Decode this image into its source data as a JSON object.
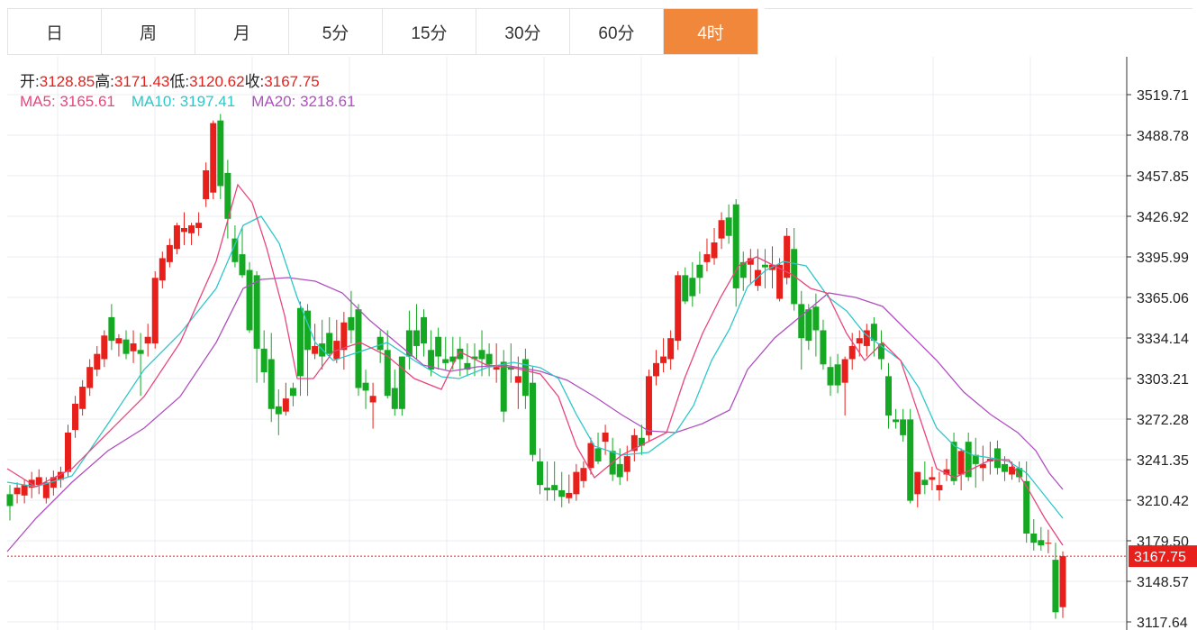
{
  "tabs": [
    {
      "label": "日"
    },
    {
      "label": "周"
    },
    {
      "label": "月"
    },
    {
      "label": "5分"
    },
    {
      "label": "15分"
    },
    {
      "label": "30分"
    },
    {
      "label": "60分"
    },
    {
      "label": "4时"
    }
  ],
  "active_tab_index": 7,
  "colors": {
    "up": "#e8201b",
    "down": "#14a823",
    "active_tab": "#f1873b",
    "ma5": "#e8467c",
    "ma10": "#2ec7c9",
    "ma20": "#b04fc0",
    "grid": "#e8ecf2"
  },
  "ohlc": {
    "open_label": "开:",
    "open": "3128.85",
    "high_label": "高:",
    "high": "3171.43",
    "low_label": "低:",
    "low": "3120.62",
    "close_label": "收:",
    "close": "3167.75"
  },
  "ma": {
    "ma5_label": "MA5:",
    "ma5": "3165.61",
    "ma10_label": "MA10:",
    "ma10": "3197.41",
    "ma20_label": "MA20:",
    "ma20": "3218.61"
  },
  "chart_data": {
    "type": "candlestick",
    "y_ticks": [
      "3519.71",
      "3488.78",
      "3457.85",
      "3426.92",
      "3395.99",
      "3365.06",
      "3334.14",
      "3303.21",
      "3272.28",
      "3241.35",
      "3210.42",
      "3179.50",
      "3148.57",
      "3117.64"
    ],
    "ylim": [
      3110,
      3545
    ],
    "current_price_label": "3167.75",
    "current_price": 3167.75,
    "candles": [
      [
        3215,
        3222,
        3195,
        3206
      ],
      [
        3215,
        3224,
        3208,
        3220
      ],
      [
        3214,
        3226,
        3208,
        3222
      ],
      [
        3220,
        3232,
        3212,
        3226
      ],
      [
        3222,
        3234,
        3215,
        3228
      ],
      [
        3212,
        3228,
        3208,
        3224
      ],
      [
        3220,
        3233,
        3214,
        3228
      ],
      [
        3226,
        3236,
        3220,
        3232
      ],
      [
        3232,
        3268,
        3228,
        3262
      ],
      [
        3264,
        3290,
        3258,
        3284
      ],
      [
        3280,
        3302,
        3275,
        3297
      ],
      [
        3296,
        3318,
        3290,
        3312
      ],
      [
        3310,
        3328,
        3305,
        3322
      ],
      [
        3318,
        3340,
        3312,
        3336
      ],
      [
        3350,
        3360,
        3325,
        3332
      ],
      [
        3330,
        3337,
        3320,
        3334
      ],
      [
        3333,
        3340,
        3318,
        3322
      ],
      [
        3324,
        3340,
        3315,
        3330
      ],
      [
        3325,
        3338,
        3290,
        3322
      ],
      [
        3330,
        3345,
        3320,
        3335
      ],
      [
        3330,
        3385,
        3326,
        3380
      ],
      [
        3378,
        3400,
        3372,
        3395
      ],
      [
        3392,
        3410,
        3388,
        3405
      ],
      [
        3402,
        3422,
        3398,
        3420
      ],
      [
        3415,
        3430,
        3405,
        3418
      ],
      [
        3414,
        3422,
        3405,
        3420
      ],
      [
        3418,
        3430,
        3412,
        3422
      ],
      [
        3440,
        3468,
        3434,
        3462
      ],
      [
        3445,
        3500,
        3440,
        3498
      ],
      [
        3500,
        3505,
        3440,
        3450
      ],
      [
        3460,
        3470,
        3410,
        3425
      ],
      [
        3410,
        3420,
        3388,
        3392
      ],
      [
        3398,
        3418,
        3380,
        3382
      ],
      [
        3386,
        3392,
        3338,
        3340
      ],
      [
        3382,
        3385,
        3300,
        3326
      ],
      [
        3326,
        3340,
        3300,
        3308
      ],
      [
        3318,
        3338,
        3270,
        3280
      ],
      [
        3282,
        3295,
        3260,
        3276
      ],
      [
        3278,
        3300,
        3275,
        3288
      ],
      [
        3296,
        3300,
        3282,
        3290
      ],
      [
        3357,
        3362,
        3290,
        3305
      ],
      [
        3355,
        3360,
        3290,
        3325
      ],
      [
        3322,
        3345,
        3318,
        3328
      ],
      [
        3330,
        3348,
        3310,
        3320
      ],
      [
        3338,
        3350,
        3320,
        3322
      ],
      [
        3318,
        3348,
        3315,
        3332
      ],
      [
        3325,
        3354,
        3310,
        3346
      ],
      [
        3350,
        3370,
        3330,
        3340
      ],
      [
        3356,
        3360,
        3290,
        3296
      ],
      [
        3300,
        3310,
        3280,
        3294
      ],
      [
        3285,
        3300,
        3265,
        3290
      ],
      [
        3335,
        3340,
        3315,
        3325
      ],
      [
        3325,
        3340,
        3288,
        3290
      ],
      [
        3296,
        3310,
        3275,
        3280
      ],
      [
        3320,
        3320,
        3275,
        3280
      ],
      [
        3340,
        3355,
        3310,
        3320
      ],
      [
        3340,
        3360,
        3318,
        3328
      ],
      [
        3350,
        3356,
        3320,
        3330
      ],
      [
        3325,
        3340,
        3305,
        3310
      ],
      [
        3335,
        3342,
        3310,
        3320
      ],
      [
        3318,
        3335,
        3310,
        3315
      ],
      [
        3320,
        3335,
        3310,
        3316
      ],
      [
        3326,
        3335,
        3305,
        3318
      ],
      [
        3315,
        3330,
        3305,
        3310
      ],
      [
        3320,
        3330,
        3305,
        3318
      ],
      [
        3325,
        3340,
        3305,
        3318
      ],
      [
        3322,
        3330,
        3305,
        3314
      ],
      [
        3310,
        3330,
        3300,
        3312
      ],
      [
        3316,
        3325,
        3270,
        3278
      ],
      [
        3312,
        3330,
        3300,
        3310
      ],
      [
        3300,
        3320,
        3280,
        3305
      ],
      [
        3318,
        3326,
        3280,
        3290
      ],
      [
        3300,
        3312,
        3240,
        3245
      ],
      [
        3240,
        3250,
        3215,
        3222
      ],
      [
        3220,
        3240,
        3210,
        3218
      ],
      [
        3222,
        3240,
        3210,
        3218
      ],
      [
        3218,
        3232,
        3205,
        3213
      ],
      [
        3212,
        3230,
        3208,
        3216
      ],
      [
        3215,
        3238,
        3210,
        3232
      ],
      [
        3225,
        3240,
        3220,
        3235
      ],
      [
        3235,
        3258,
        3230,
        3254
      ],
      [
        3250,
        3262,
        3238,
        3240
      ],
      [
        3255,
        3268,
        3245,
        3262
      ],
      [
        3248,
        3258,
        3225,
        3230
      ],
      [
        3238,
        3250,
        3222,
        3228
      ],
      [
        3232,
        3252,
        3225,
        3244
      ],
      [
        3248,
        3265,
        3240,
        3260
      ],
      [
        3258,
        3268,
        3245,
        3252
      ],
      [
        3260,
        3310,
        3255,
        3305
      ],
      [
        3305,
        3325,
        3298,
        3315
      ],
      [
        3315,
        3334,
        3308,
        3320
      ],
      [
        3318,
        3340,
        3310,
        3334
      ],
      [
        3332,
        3385,
        3325,
        3382
      ],
      [
        3382,
        3388,
        3360,
        3362
      ],
      [
        3380,
        3392,
        3358,
        3366
      ],
      [
        3390,
        3400,
        3368,
        3380
      ],
      [
        3392,
        3410,
        3385,
        3398
      ],
      [
        3395,
        3418,
        3390,
        3407
      ],
      [
        3410,
        3430,
        3402,
        3424
      ],
      [
        3426,
        3436,
        3406,
        3412
      ],
      [
        3436,
        3440,
        3358,
        3372
      ],
      [
        3392,
        3400,
        3370,
        3380
      ],
      [
        3390,
        3402,
        3375,
        3395
      ],
      [
        3374,
        3402,
        3370,
        3386
      ],
      [
        3390,
        3402,
        3372,
        3388
      ],
      [
        3386,
        3404,
        3372,
        3390
      ],
      [
        3364,
        3395,
        3362,
        3390
      ],
      [
        3380,
        3418,
        3375,
        3412
      ],
      [
        3402,
        3418,
        3355,
        3360
      ],
      [
        3360,
        3370,
        3310,
        3334
      ],
      [
        3356,
        3360,
        3325,
        3332
      ],
      [
        3358,
        3368,
        3320,
        3340
      ],
      [
        3340,
        3348,
        3310,
        3314
      ],
      [
        3312,
        3320,
        3290,
        3298
      ],
      [
        3314,
        3322,
        3292,
        3298
      ],
      [
        3300,
        3320,
        3275,
        3318
      ],
      [
        3318,
        3338,
        3310,
        3328
      ],
      [
        3330,
        3340,
        3320,
        3334
      ],
      [
        3328,
        3345,
        3320,
        3340
      ],
      [
        3345,
        3350,
        3320,
        3332
      ],
      [
        3330,
        3340,
        3310,
        3318
      ],
      [
        3305,
        3315,
        3265,
        3275
      ],
      [
        3272,
        3280,
        3265,
        3270
      ],
      [
        3272,
        3280,
        3255,
        3260
      ],
      [
        3272,
        3280,
        3208,
        3210
      ],
      [
        3215,
        3232,
        3205,
        3232
      ],
      [
        3226,
        3240,
        3215,
        3222
      ],
      [
        3226,
        3236,
        3218,
        3228
      ],
      [
        3218,
        3232,
        3210,
        3222
      ],
      [
        3230,
        3242,
        3225,
        3234
      ],
      [
        3255,
        3262,
        3222,
        3225
      ],
      [
        3230,
        3250,
        3218,
        3248
      ],
      [
        3255,
        3262,
        3225,
        3228
      ],
      [
        3245,
        3258,
        3220,
        3238
      ],
      [
        3235,
        3252,
        3225,
        3238
      ],
      [
        3240,
        3255,
        3230,
        3242
      ],
      [
        3250,
        3256,
        3230,
        3235
      ],
      [
        3238,
        3244,
        3225,
        3232
      ],
      [
        3230,
        3240,
        3226,
        3236
      ],
      [
        3235,
        3240,
        3224,
        3228
      ],
      [
        3225,
        3240,
        3178,
        3185
      ],
      [
        3185,
        3196,
        3172,
        3178
      ],
      [
        3180,
        3190,
        3172,
        3176
      ],
      [
        3178,
        3188,
        3170,
        3178
      ],
      [
        3165,
        3178,
        3120,
        3125
      ],
      [
        3128.85,
        3171.43,
        3120.62,
        3167.75
      ]
    ],
    "ma5": [
      [
        8,
        520
      ],
      [
        40,
        540
      ],
      [
        80,
        520
      ],
      [
        120,
        480
      ],
      [
        160,
        440
      ],
      [
        200,
        380
      ],
      [
        240,
        290
      ],
      [
        264,
        205
      ],
      [
        280,
        225
      ],
      [
        296,
        275
      ],
      [
        316,
        350
      ],
      [
        330,
        420
      ],
      [
        348,
        420
      ],
      [
        370,
        390
      ],
      [
        400,
        380
      ],
      [
        430,
        395
      ],
      [
        460,
        420
      ],
      [
        490,
        432
      ],
      [
        510,
        390
      ],
      [
        540,
        405
      ],
      [
        570,
        408
      ],
      [
        600,
        415
      ],
      [
        620,
        440
      ],
      [
        640,
        495
      ],
      [
        660,
        530
      ],
      [
        690,
        505
      ],
      [
        720,
        490
      ],
      [
        740,
        480
      ],
      [
        760,
        420
      ],
      [
        780,
        370
      ],
      [
        800,
        330
      ],
      [
        820,
        295
      ],
      [
        840,
        285
      ],
      [
        860,
        295
      ],
      [
        880,
        305
      ],
      [
        900,
        320
      ],
      [
        918,
        325
      ],
      [
        940,
        370
      ],
      [
        960,
        400
      ],
      [
        980,
        380
      ],
      [
        1000,
        400
      ],
      [
        1020,
        460
      ],
      [
        1040,
        520
      ],
      [
        1060,
        530
      ],
      [
        1080,
        520
      ],
      [
        1100,
        510
      ],
      [
        1120,
        510
      ],
      [
        1140,
        540
      ],
      [
        1160,
        575
      ],
      [
        1180,
        605
      ]
    ],
    "ma10": [
      [
        8,
        535
      ],
      [
        40,
        540
      ],
      [
        80,
        528
      ],
      [
        120,
        470
      ],
      [
        160,
        410
      ],
      [
        200,
        370
      ],
      [
        240,
        320
      ],
      [
        270,
        250
      ],
      [
        290,
        240
      ],
      [
        310,
        270
      ],
      [
        330,
        330
      ],
      [
        350,
        380
      ],
      [
        370,
        400
      ],
      [
        400,
        390
      ],
      [
        430,
        380
      ],
      [
        460,
        400
      ],
      [
        490,
        418
      ],
      [
        510,
        420
      ],
      [
        540,
        408
      ],
      [
        570,
        402
      ],
      [
        600,
        408
      ],
      [
        620,
        420
      ],
      [
        640,
        460
      ],
      [
        660,
        495
      ],
      [
        690,
        505
      ],
      [
        720,
        502
      ],
      [
        750,
        480
      ],
      [
        770,
        450
      ],
      [
        790,
        400
      ],
      [
        810,
        365
      ],
      [
        830,
        318
      ],
      [
        850,
        300
      ],
      [
        870,
        290
      ],
      [
        895,
        295
      ],
      [
        920,
        330
      ],
      [
        940,
        345
      ],
      [
        960,
        370
      ],
      [
        980,
        385
      ],
      [
        1000,
        400
      ],
      [
        1020,
        430
      ],
      [
        1040,
        475
      ],
      [
        1060,
        495
      ],
      [
        1080,
        505
      ],
      [
        1100,
        508
      ],
      [
        1120,
        512
      ],
      [
        1140,
        525
      ],
      [
        1160,
        550
      ],
      [
        1180,
        575
      ]
    ],
    "ma20": [
      [
        8,
        612
      ],
      [
        40,
        575
      ],
      [
        80,
        535
      ],
      [
        120,
        500
      ],
      [
        160,
        475
      ],
      [
        200,
        440
      ],
      [
        240,
        380
      ],
      [
        270,
        320
      ],
      [
        290,
        310
      ],
      [
        320,
        308
      ],
      [
        350,
        312
      ],
      [
        380,
        325
      ],
      [
        410,
        355
      ],
      [
        440,
        380
      ],
      [
        470,
        405
      ],
      [
        500,
        412
      ],
      [
        530,
        407
      ],
      [
        560,
        405
      ],
      [
        600,
        412
      ],
      [
        630,
        422
      ],
      [
        660,
        440
      ],
      [
        690,
        460
      ],
      [
        720,
        478
      ],
      [
        750,
        480
      ],
      [
        780,
        470
      ],
      [
        810,
        455
      ],
      [
        830,
        410
      ],
      [
        860,
        375
      ],
      [
        890,
        350
      ],
      [
        920,
        325
      ],
      [
        950,
        330
      ],
      [
        980,
        340
      ],
      [
        1010,
        370
      ],
      [
        1040,
        400
      ],
      [
        1070,
        435
      ],
      [
        1100,
        460
      ],
      [
        1130,
        480
      ],
      [
        1150,
        500
      ],
      [
        1165,
        525
      ],
      [
        1180,
        543
      ]
    ]
  }
}
